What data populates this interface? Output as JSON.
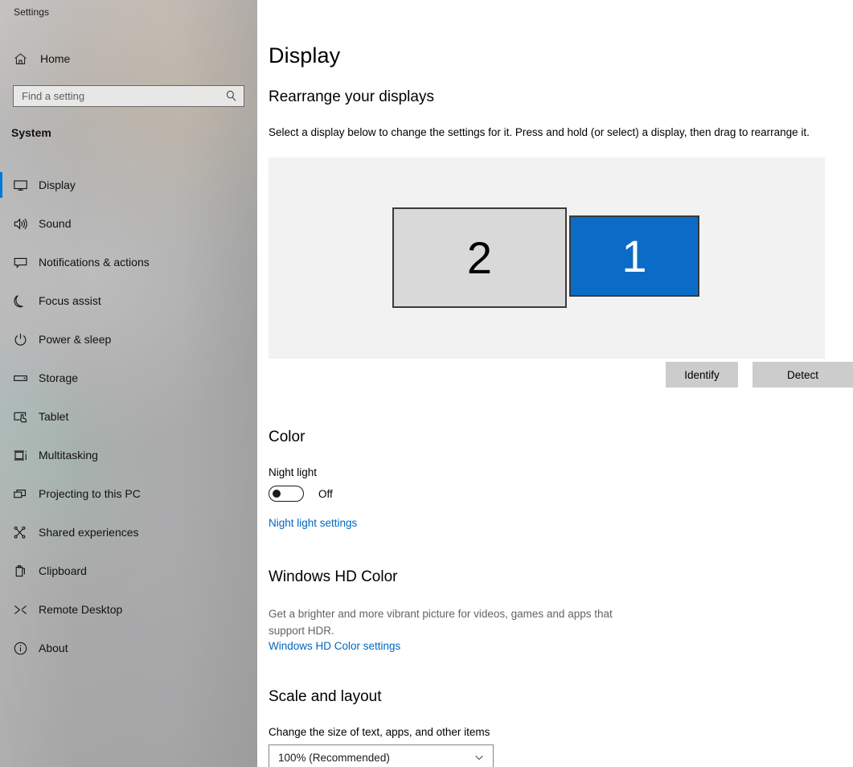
{
  "window": {
    "title": "Settings"
  },
  "sidebar": {
    "home_label": "Home",
    "search": {
      "placeholder": "Find a setting",
      "value": ""
    },
    "section_label": "System",
    "items": [
      {
        "label": "Display",
        "icon": "monitor-icon",
        "selected": true
      },
      {
        "label": "Sound",
        "icon": "speaker-icon",
        "selected": false
      },
      {
        "label": "Notifications & actions",
        "icon": "notification-icon",
        "selected": false
      },
      {
        "label": "Focus assist",
        "icon": "moon-icon",
        "selected": false
      },
      {
        "label": "Power & sleep",
        "icon": "power-icon",
        "selected": false
      },
      {
        "label": "Storage",
        "icon": "drive-icon",
        "selected": false
      },
      {
        "label": "Tablet",
        "icon": "tablet-icon",
        "selected": false
      },
      {
        "label": "Multitasking",
        "icon": "multitasking-icon",
        "selected": false
      },
      {
        "label": "Projecting to this PC",
        "icon": "projecting-icon",
        "selected": false
      },
      {
        "label": "Shared experiences",
        "icon": "shared-experiences-icon",
        "selected": false
      },
      {
        "label": "Clipboard",
        "icon": "clipboard-icon",
        "selected": false
      },
      {
        "label": "Remote Desktop",
        "icon": "remote-desktop-icon",
        "selected": false
      },
      {
        "label": "About",
        "icon": "info-icon",
        "selected": false
      }
    ]
  },
  "main": {
    "page_title": "Display",
    "rearrange": {
      "heading": "Rearrange your displays",
      "description": "Select a display below to change the settings for it. Press and hold (or select) a display, then drag to rearrange it.",
      "displays": [
        {
          "number": "2",
          "selected": false
        },
        {
          "number": "1",
          "selected": true
        }
      ],
      "identify_label": "Identify",
      "detect_label": "Detect"
    },
    "color": {
      "heading": "Color",
      "night_light_label": "Night light",
      "night_light_state": "Off",
      "night_light_link": "Night light settings"
    },
    "hd_color": {
      "heading": "Windows HD Color",
      "description": "Get a brighter and more vibrant picture for videos, games and apps that support HDR.",
      "link": "Windows HD Color settings"
    },
    "scale": {
      "heading": "Scale and layout",
      "size_label": "Change the size of text, apps, and other items",
      "size_value": "100% (Recommended)"
    }
  },
  "colors": {
    "accent": "#0078d7",
    "selected_display": "#0a6cc6",
    "link": "#0067c0",
    "canvas_bg": "#f2f2f2",
    "button_bg": "#cccccc"
  }
}
